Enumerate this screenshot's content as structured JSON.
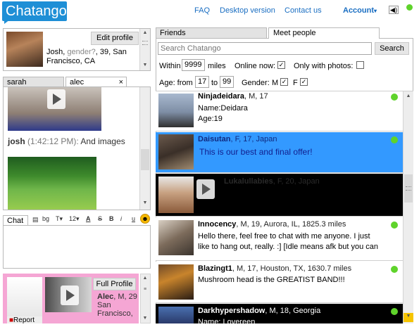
{
  "app": {
    "logo": "Chatango"
  },
  "nav": {
    "faq": "FAQ",
    "desktop": "Desktop version",
    "contact": "Contact us",
    "account": "Account",
    "account_caret": "▾"
  },
  "profile": {
    "edit_button": "Edit profile",
    "name": "Josh",
    "gender_label": "gender?",
    "age": "39",
    "location": "San Francisco, CA"
  },
  "chat_tabs": [
    {
      "label": "sarah"
    },
    {
      "label": "alec",
      "close": "×"
    }
  ],
  "messages": {
    "user": "josh",
    "time": "(1:42:12 PM):",
    "text": "And images"
  },
  "composer": {
    "tab": "Chat",
    "font_size": "12",
    "bold": "B",
    "italic": "i",
    "underline": "u",
    "strike": "S",
    "color_glyph": "A",
    "type_glyph": "T",
    "bg_glyph": "bg"
  },
  "bottom_profile": {
    "full_profile": "Full Profile",
    "name": "Alec",
    "gender": "M",
    "age": "29",
    "location_line1": "San",
    "location_line2": "Francisco,",
    "report": "Report"
  },
  "tabs": {
    "friends": "Friends",
    "meet": "Meet people"
  },
  "search": {
    "placeholder": "Search Chatango",
    "button": "Search"
  },
  "filters": {
    "within_label": "Within",
    "miles_value": "9999",
    "miles_label": "miles",
    "online_label": "Online now:",
    "online_checked": "✓",
    "photos_label": "Only with photos:",
    "age_label": "Age: from",
    "age_from": "17",
    "age_to_label": "to",
    "age_to": "99",
    "gender_label": "Gender:",
    "m_label": "M",
    "m_checked": "✓",
    "f_label": "F",
    "f_checked": "✓"
  },
  "results": [
    {
      "name": "Ninjadeidara",
      "meta": ", M, 17",
      "line1": "Name:Deidara",
      "line2": "Age:19"
    },
    {
      "name": "Daisutan",
      "meta": ", F, 17, Japan",
      "line1": "This is our best and final offer!"
    },
    {
      "name": "Lukalullabies",
      "meta": ", F, 20, Japan"
    },
    {
      "name": "Innocency",
      "meta": ", M, 19, Aurora, IL, 1825.3 miles",
      "line1": "Hello there, feel free to chat with me anyone. I just",
      "line2": "like to hang out, really. :] [Idle means afk but you can"
    },
    {
      "name": "Blazingt1",
      "meta": ", M, 17, Houston, TX, 1630.7 miles",
      "line1": "Mushroom head is the GREATIST BAND!!!"
    },
    {
      "name": "Darkhypershadow",
      "meta": ", M, 18, Georgia",
      "line1": "Name: Lovereen"
    }
  ],
  "colors": {
    "brand": "#1e8fd6",
    "selected": "#3399ff",
    "online": "#5fd32b",
    "dark_row": "#000000",
    "profile_bg": "#f5a6d4"
  }
}
